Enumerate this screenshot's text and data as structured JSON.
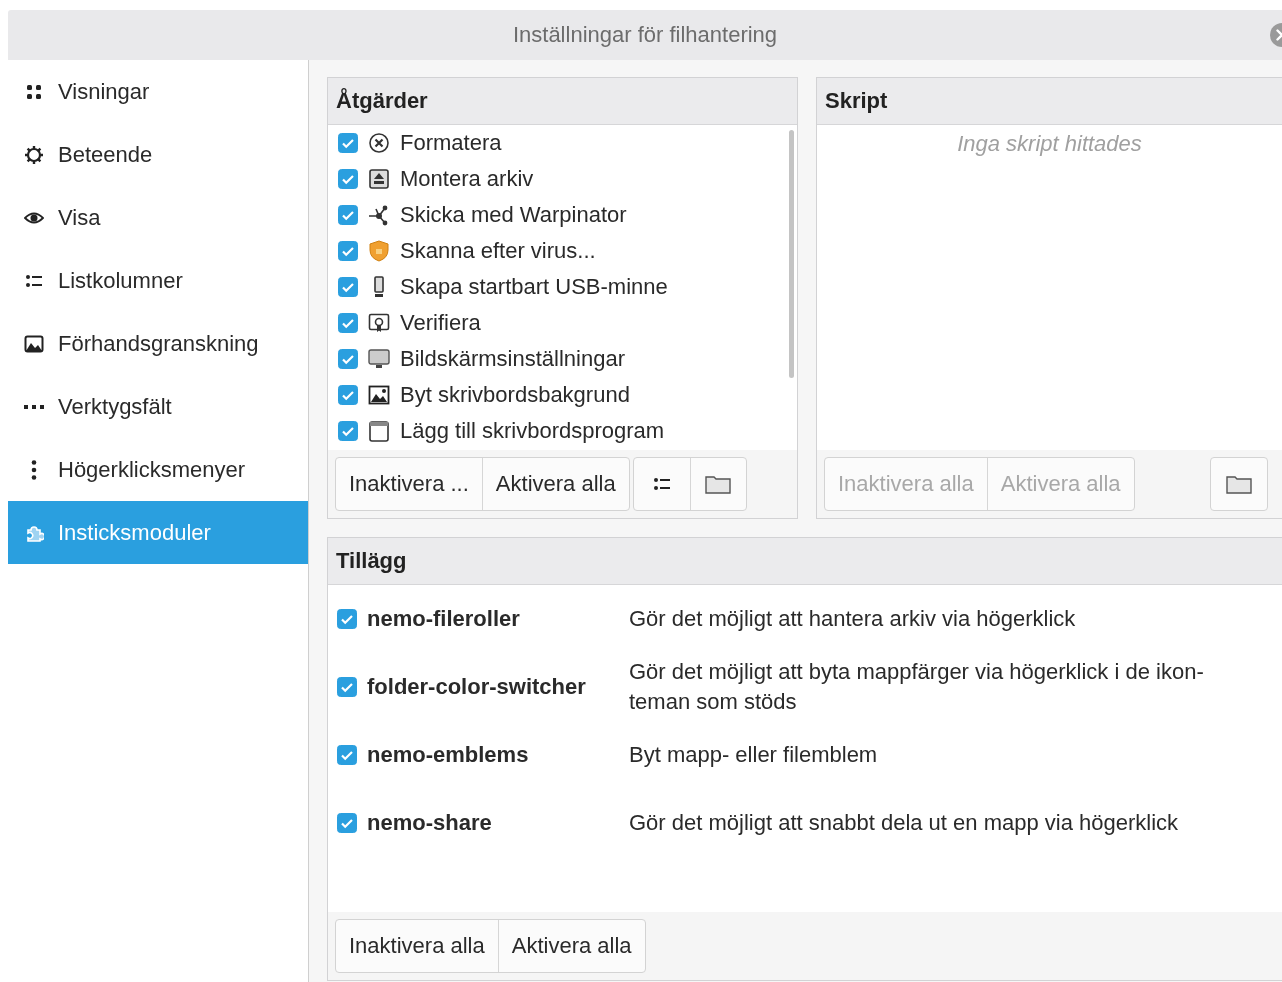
{
  "window": {
    "title": "Inställningar för filhantering"
  },
  "sidebar": {
    "items": [
      {
        "label": "Visningar",
        "selected": false
      },
      {
        "label": "Beteende",
        "selected": false
      },
      {
        "label": "Visa",
        "selected": false
      },
      {
        "label": "Listkolumner",
        "selected": false
      },
      {
        "label": "Förhandsgranskning",
        "selected": false
      },
      {
        "label": "Verktygsfält",
        "selected": false
      },
      {
        "label": "Högerklicksmenyer",
        "selected": false
      },
      {
        "label": "Insticksmoduler",
        "selected": true
      }
    ]
  },
  "actions": {
    "title": "Åtgärder",
    "items": [
      {
        "label": "Formatera",
        "checked": true
      },
      {
        "label": "Montera arkiv",
        "checked": true
      },
      {
        "label": "Skicka med Warpinator",
        "checked": true
      },
      {
        "label": "Skanna efter virus...",
        "checked": true
      },
      {
        "label": "Skapa startbart USB-minne",
        "checked": true
      },
      {
        "label": "Verifiera",
        "checked": true
      },
      {
        "label": "Bildskärmsinställningar",
        "checked": true
      },
      {
        "label": "Byt skrivbordsbakgrund",
        "checked": true
      },
      {
        "label": "Lägg till skrivbordsprogram",
        "checked": true
      }
    ],
    "buttons": [
      {
        "label": "Inaktivera ...",
        "disabled": false
      },
      {
        "label": "Aktivera alla",
        "disabled": false
      }
    ]
  },
  "scripts": {
    "title": "Skript",
    "empty_message": "Inga skript hittades",
    "buttons": [
      {
        "label": "Inaktivera alla",
        "disabled": true
      },
      {
        "label": "Aktivera alla",
        "disabled": true
      }
    ]
  },
  "extensions": {
    "title": "Tillägg",
    "items": [
      {
        "name": "nemo-fileroller",
        "description": "Gör det möjligt att hantera arkiv via högerklick",
        "checked": true
      },
      {
        "name": "folder-color-switcher",
        "description": "Gör det möjligt att byta mappfärger via högerklick i de ikon-teman som stöds",
        "checked": true
      },
      {
        "name": "nemo-emblems",
        "description": "Byt mapp- eller filemblem",
        "checked": true
      },
      {
        "name": "nemo-share",
        "description": "Gör det möjligt att snabbt dela ut en mapp via högerklick",
        "checked": true
      }
    ],
    "buttons": [
      {
        "label": "Inaktivera alla",
        "disabled": false
      },
      {
        "label": "Aktivera alla",
        "disabled": false
      }
    ]
  }
}
